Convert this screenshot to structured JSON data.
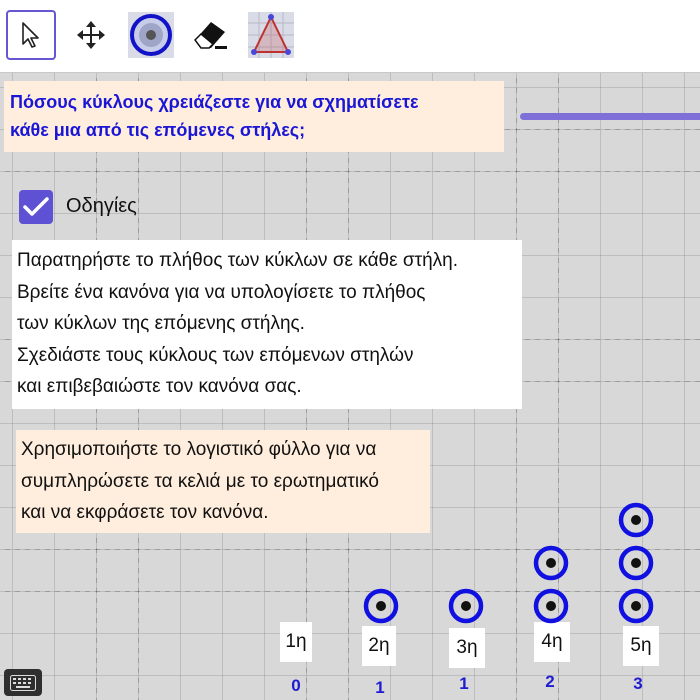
{
  "toolbar": {
    "tools": [
      {
        "name": "select",
        "icon": "arrow-pointer-icon",
        "active": true
      },
      {
        "name": "move",
        "icon": "move-arrows-icon",
        "active": false
      },
      {
        "name": "circle",
        "icon": "target-circle-icon",
        "active": false
      },
      {
        "name": "eraser",
        "icon": "eraser-icon",
        "active": false
      },
      {
        "name": "triangle",
        "icon": "triangle-icon",
        "active": false
      }
    ]
  },
  "title": {
    "line1": "Πόσους κύκλους χρειάζεστε για να σχηματίσετε",
    "line2": "κάθε μια από τις επόμενες στήλες;"
  },
  "checkbox": {
    "label": "Οδηγίες",
    "checked": true
  },
  "instructions": {
    "lines": [
      "Παρατηρήστε το πλήθος των κύκλων σε κάθε στήλη.",
      "Βρείτε ένα κανόνα για να υπολογίσετε το πλήθος",
      "των κύκλων της επόμενης στήλης.",
      "Σχεδιάστε τους κύκλους των επόμενων στηλών",
      "και επιβεβαιώστε τον κανόνα σας."
    ]
  },
  "spreadsheet_note": {
    "lines": [
      "Χρησιμοποιήστε το λογιστικό φύλλο για να",
      "συμπληρώσετε τα κελιά με το ερωτηματικό",
      "και να εκφράσετε τον κανόνα."
    ]
  },
  "columns": [
    {
      "label": "1η",
      "value": "0",
      "circles": 0
    },
    {
      "label": "2η",
      "value": "1",
      "circles": 1
    },
    {
      "label": "3η",
      "value": "1",
      "circles": 1
    },
    {
      "label": "4η",
      "value": "2",
      "circles": 2
    },
    {
      "label": "5η",
      "value": "3",
      "circles": 3
    }
  ],
  "colors": {
    "accent": "#5e51d4",
    "title_text": "#1a16d6",
    "circle": "#1010e0",
    "value_text": "#1f1bd2"
  }
}
